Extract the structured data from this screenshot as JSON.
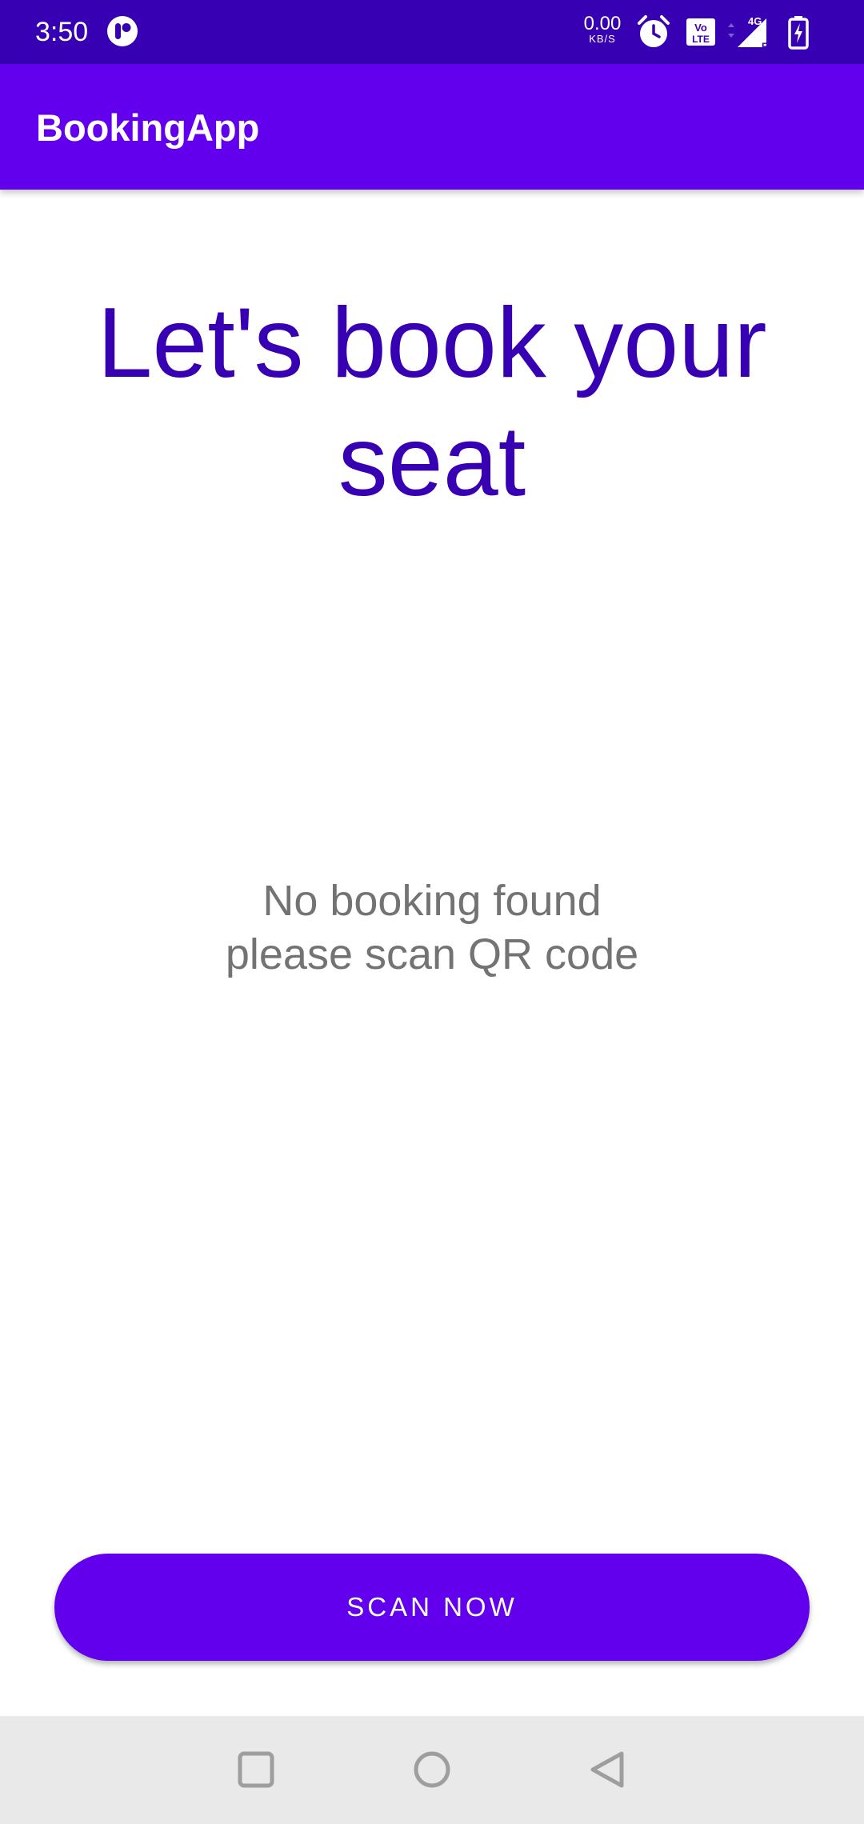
{
  "status_bar": {
    "time": "3:50",
    "net_speed": "0.00",
    "net_speed_unit": "KB/S",
    "icons": [
      "app-notification-icon",
      "alarm-icon",
      "volte-icon",
      "signal-4g-icon",
      "battery-charging-icon"
    ],
    "volte_top": "Vo",
    "volte_bottom": "LTE",
    "network_label": "4G",
    "roaming_label": "R",
    "background_color": "#3700b3"
  },
  "app_bar": {
    "title": "BookingApp",
    "background_color": "#6200ee"
  },
  "main": {
    "headline": "Let's book your seat",
    "message_line1": "No booking found",
    "message_line2": "please scan QR code",
    "headline_color": "#3700b3",
    "message_color": "#737373"
  },
  "scan_button": {
    "label": "SCAN NOW",
    "color": "#6200ee"
  },
  "nav_bar": {
    "buttons": [
      "recents-icon",
      "home-icon",
      "back-icon"
    ]
  }
}
